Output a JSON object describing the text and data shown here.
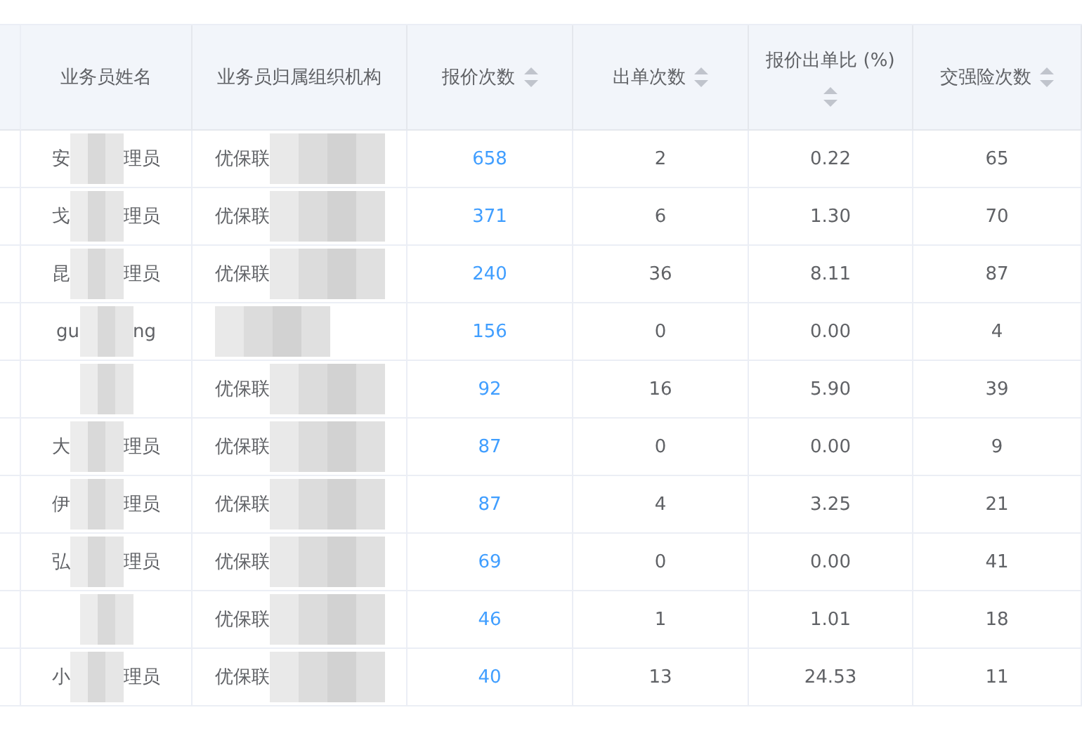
{
  "table": {
    "columns": [
      {
        "label": "业务员姓名",
        "sortable": false
      },
      {
        "label": "业务员归属组织机构",
        "sortable": false
      },
      {
        "label": "报价次数",
        "sortable": true
      },
      {
        "label": "出单次数",
        "sortable": true
      },
      {
        "label": "报价出单比 (%)",
        "sortable": true
      },
      {
        "label": "交强险次数",
        "sortable": true
      }
    ],
    "rows": [
      {
        "name_start": "安",
        "name_end": "理员",
        "org_start": "优保联",
        "quotes": "658",
        "orders": "2",
        "ratio": "0.22",
        "compulsory": "65"
      },
      {
        "name_start": "戈",
        "name_end": "理员",
        "org_start": "优保联",
        "quotes": "371",
        "orders": "6",
        "ratio": "1.30",
        "compulsory": "70"
      },
      {
        "name_start": "昆",
        "name_end": "理员",
        "org_start": "优保联",
        "quotes": "240",
        "orders": "36",
        "ratio": "8.11",
        "compulsory": "87"
      },
      {
        "name_start": "gu",
        "name_end": "ng",
        "quotes": "156",
        "orders": "0",
        "ratio": "0.00",
        "compulsory": "4"
      },
      {
        "quotes": "92",
        "orders": "16",
        "ratio": "5.90",
        "compulsory": "39",
        "org_start": "优保联"
      },
      {
        "name_start": "大",
        "name_end": "理员",
        "org_start": "优保联",
        "quotes": "87",
        "orders": "0",
        "ratio": "0.00",
        "compulsory": "9"
      },
      {
        "name_start": "伊",
        "name_end": "理员",
        "org_start": "优保联",
        "quotes": "87",
        "orders": "4",
        "ratio": "3.25",
        "compulsory": "21"
      },
      {
        "name_start": "弘",
        "name_end": "理员",
        "org_start": "优保联",
        "quotes": "69",
        "orders": "0",
        "ratio": "0.00",
        "compulsory": "41"
      },
      {
        "org_start": "优保联",
        "quotes": "46",
        "orders": "1",
        "ratio": "1.01",
        "compulsory": "18"
      },
      {
        "name_start": "小",
        "name_end": "理员",
        "org_start": "优保联",
        "quotes": "40",
        "orders": "13",
        "ratio": "24.53",
        "compulsory": "11"
      }
    ]
  }
}
